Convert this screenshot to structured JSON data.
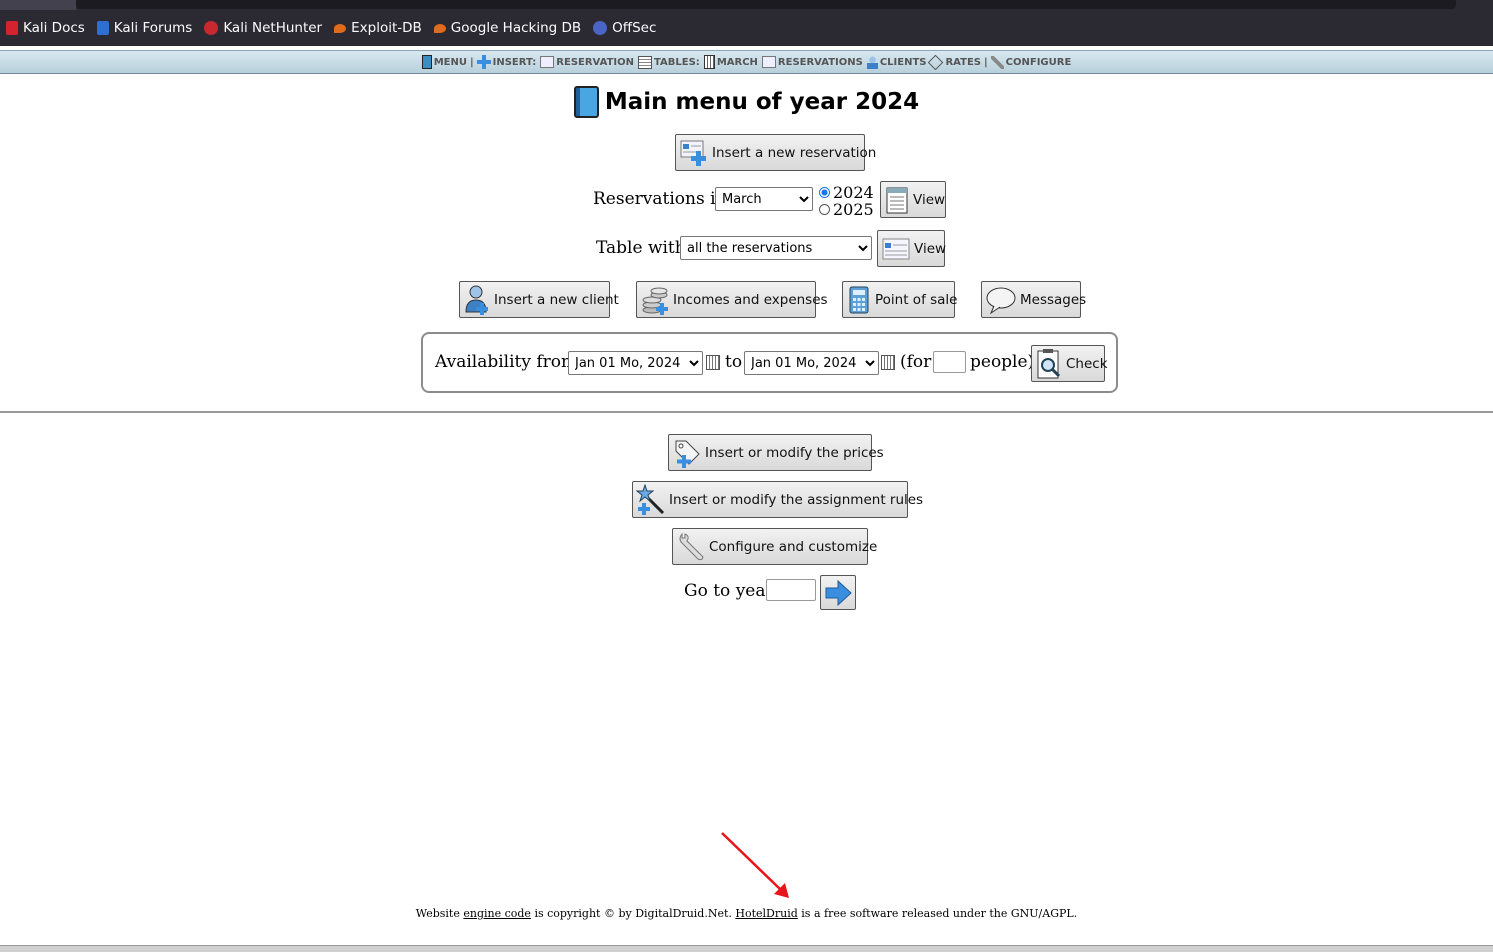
{
  "bookmarks": [
    {
      "label": "Kali Docs",
      "icon": "kali-icon"
    },
    {
      "label": "Kali Forums",
      "icon": "forums-icon"
    },
    {
      "label": "Kali NetHunter",
      "icon": "nethunter-icon"
    },
    {
      "label": "Exploit-DB",
      "icon": "exploit-db-icon"
    },
    {
      "label": "Google Hacking DB",
      "icon": "ghdb-icon"
    },
    {
      "label": "OffSec",
      "icon": "offsec-icon"
    }
  ],
  "menubar": {
    "menu": "MENU",
    "sep1": "|",
    "insert": "INSERT:",
    "reservation": "RESERVATION",
    "tables": "TABLES:",
    "march": "MARCH",
    "reservations": "RESERVATIONS",
    "clients": "CLIENTS",
    "rates": "RATES",
    "sep2": "|",
    "configure": "CONFIGURE"
  },
  "main": {
    "title": "Main menu of year 2024",
    "insert_reservation": "Insert a new reservation",
    "reservations_in_label": "Reservations in",
    "month_selected": "March",
    "year_options": [
      "2024",
      "2025"
    ],
    "year_selected": "2024",
    "view_label": "View",
    "table_with_label": "Table with",
    "table_selected": "all the reservations",
    "insert_client": "Insert a new client",
    "incomes_expenses": "Incomes and expenses",
    "point_of_sale": "Point of sale",
    "messages": "Messages",
    "availability_from": "Availability from",
    "date_from": "Jan 01 Mo, 2024",
    "to_label": "to",
    "date_to": "Jan 01 Mo, 2024",
    "for_label": "(for",
    "people_label": "people)",
    "check_label": "Check",
    "prices": "Insert or modify the prices",
    "assignment_rules": "Insert or modify the assignment rules",
    "configure": "Configure and customize",
    "go_to_year": "Go to year"
  },
  "footer": {
    "t1": "Website ",
    "link1": "engine code",
    "t2": " is copyright © by DigitalDruid.Net. ",
    "link2": "HotelDruid",
    "t3": " is a free software released under the GNU/AGPL."
  },
  "colors": {
    "menubar_bg": "#c8dde8",
    "annotation_arrow": "#e8141a",
    "browser_chrome": "#2b2a33"
  }
}
